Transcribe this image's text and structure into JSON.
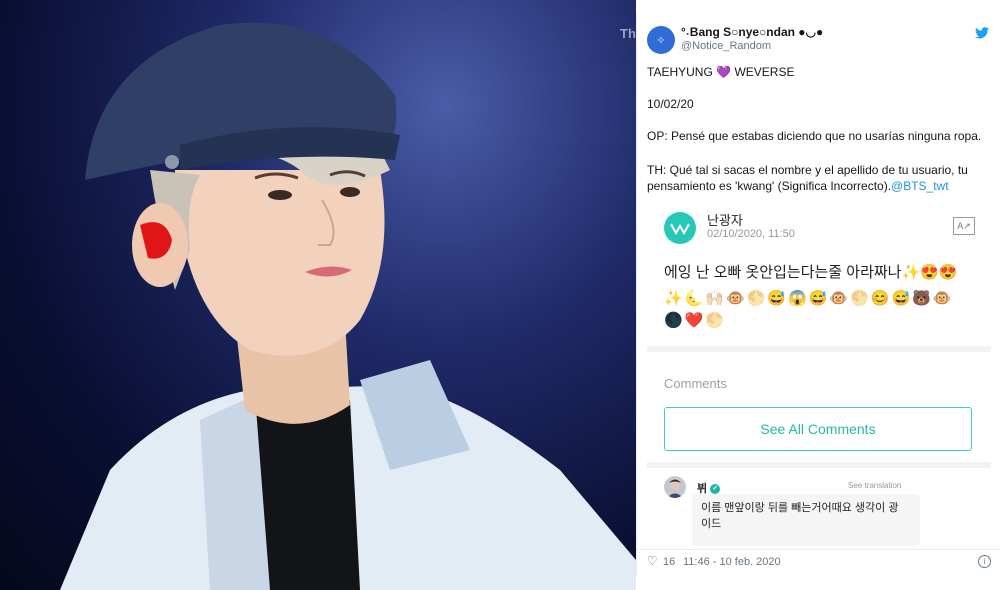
{
  "photo": {
    "watermark": "Th"
  },
  "tweet": {
    "display_name": "°˖Bang S○nye○ndan ●◡●",
    "handle": "@Notice_Random",
    "line1_prefix": "TAEHYUNG",
    "heart": "💜",
    "line1_suffix": "WEVERSE",
    "date": "10/02/20",
    "op": "OP: Pensé que estabas diciendo que no usarías ninguna ropa.",
    "th": "TH: Qué tal si sacas el nombre y el apellido de tu usuario, tu pensamiento es 'kwang' (Significa Incorrecto).",
    "mention": "@BTS_twt",
    "likes": "16",
    "timestamp": "11:46 - 10 feb. 2020"
  },
  "weverse": {
    "user": "난광자",
    "date": "02/10/2020, 11:50",
    "post": "에잉 난 오빠 옷안입는다는줄 아라짜나✨😍😍",
    "emoji_row1": "✨🌜🙌🏻🐵🌕😅😱😅🐵🌕😊😅🐻🐵",
    "emoji_row2": "🌑❤️🌕",
    "comments_label": "Comments",
    "see_all": "See All Comments",
    "comment_user": "뷔",
    "see_translation": "See translation",
    "comment_text": "이름 맨앞이랑 뒤를 빼는거어때요 생각이 광이드"
  },
  "colors": {
    "accent": "#39d0bd",
    "twitter_blue": "#1da1f2",
    "mention": "#1b95e0"
  }
}
